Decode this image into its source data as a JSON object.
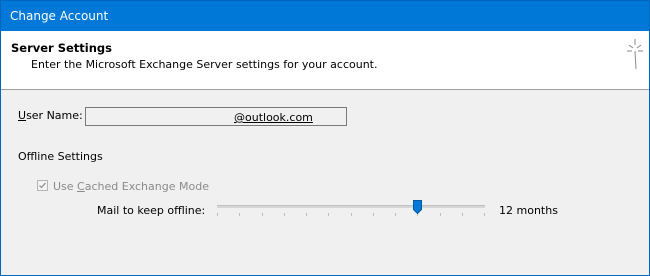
{
  "window": {
    "title": "Change Account"
  },
  "header": {
    "section_title": "Server Settings",
    "description": "Enter the Microsoft Exchange Server settings for your account."
  },
  "user_name": {
    "label_prefix": "",
    "label_underlined": "U",
    "label_rest": "ser Name:",
    "value": "@outlook.com"
  },
  "offline": {
    "heading": "Offline Settings",
    "cached_mode": {
      "checked": true,
      "enabled": false,
      "label_prefix": "Use ",
      "label_underlined": "C",
      "label_rest": "ached Exchange Mode"
    },
    "mail_to_keep": {
      "label": "Mail to keep offline:",
      "value_label": "12 months",
      "slider_position": 0.75,
      "tick_count": 13
    }
  },
  "colors": {
    "titlebar": "#0078d7",
    "accent": "#0078d7"
  }
}
